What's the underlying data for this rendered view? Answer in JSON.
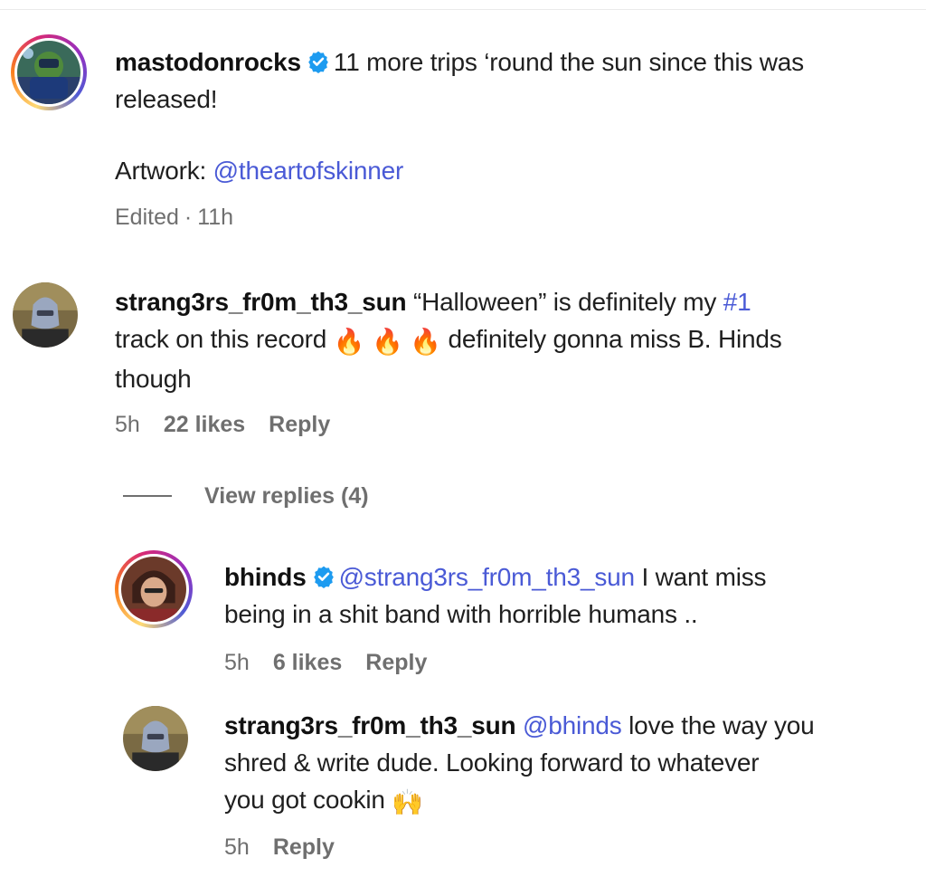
{
  "comments": [
    {
      "username": "mastodonrocks",
      "verified": true,
      "text_part1": "11 more trips ‘round the sun since this was",
      "text_part2": "released!",
      "artwork_label": "Artwork: ",
      "artwork_mention": "@theartofskinner",
      "edited": "Edited",
      "separator": "·",
      "time": "11h"
    },
    {
      "username": "strang3rs_fr0m_th3_sun",
      "text_a": "“Halloween” is definitely my ",
      "hashtag": "#1",
      "text_b": "track on this record ",
      "emoji": "🔥",
      "text_c": " definitely gonna miss B. Hinds",
      "text_d": "though",
      "time": "5h",
      "likes": "22 likes",
      "reply": "Reply",
      "view_replies": "View replies (4)"
    }
  ],
  "replies": [
    {
      "username": "bhinds",
      "verified": true,
      "mention": "@strang3rs_fr0m_th3_sun",
      "text_a": " I want miss",
      "text_b": "being in a shit band with horrible humans ..",
      "time": "5h",
      "likes": "6 likes",
      "reply": "Reply"
    },
    {
      "username": "strang3rs_fr0m_th3_sun",
      "mention": "@bhinds",
      "text_a": " love the way you",
      "text_b": "shred & write dude. Looking forward to whatever",
      "text_c": "you got cookin ",
      "emoji": "🙌",
      "time": "5h",
      "reply": "Reply"
    }
  ],
  "colors": {
    "mention": "#4a5ad6",
    "meta": "#6f6f6f",
    "verified": "#1d9bf0"
  }
}
